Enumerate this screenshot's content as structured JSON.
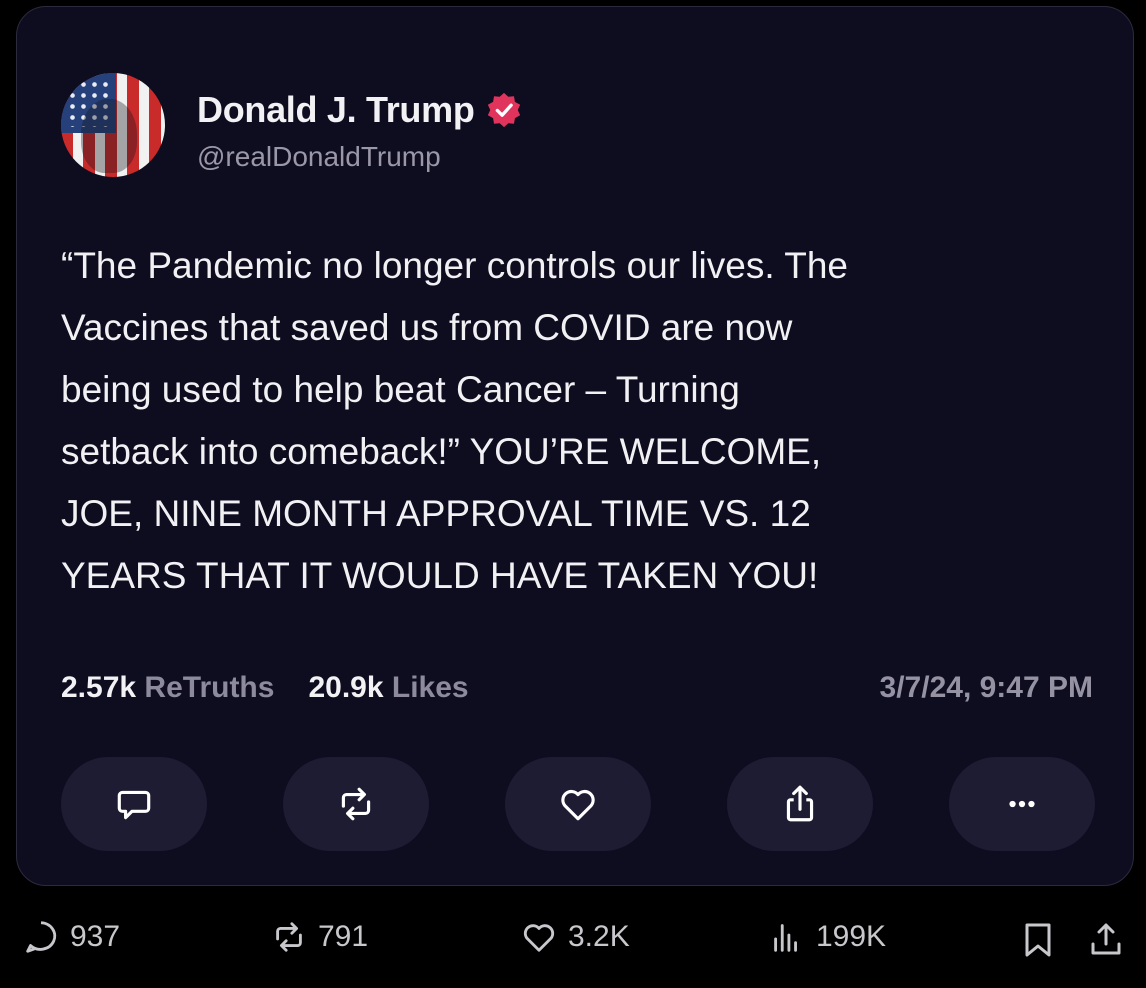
{
  "post": {
    "author_name": "Donald J. Trump",
    "handle": "@realDonaldTrump",
    "text": "“The Pandemic no longer controls our lives. The\nVaccines that saved us from COVID are now\nbeing used to help beat Cancer – Turning\nsetback into comeback!” YOU’RE WELCOME,\nJOE, NINE MONTH APPROVAL TIME VS. 12\nYEARS THAT IT WOULD HAVE TAKEN YOU!",
    "retruths_count": "2.57k",
    "retruths_label": "ReTruths",
    "likes_count": "20.9k",
    "likes_label": "Likes",
    "timestamp": "3/7/24, 9:47 PM",
    "verified_color": "#e0345d",
    "actions": [
      {
        "icon": "reply-icon"
      },
      {
        "icon": "retruth-icon"
      },
      {
        "icon": "heart-icon"
      },
      {
        "icon": "share-icon"
      },
      {
        "icon": "more-icon"
      }
    ]
  },
  "bottom_bar": {
    "replies": "937",
    "reposts": "791",
    "likes": "3.2K",
    "views": "199K"
  }
}
